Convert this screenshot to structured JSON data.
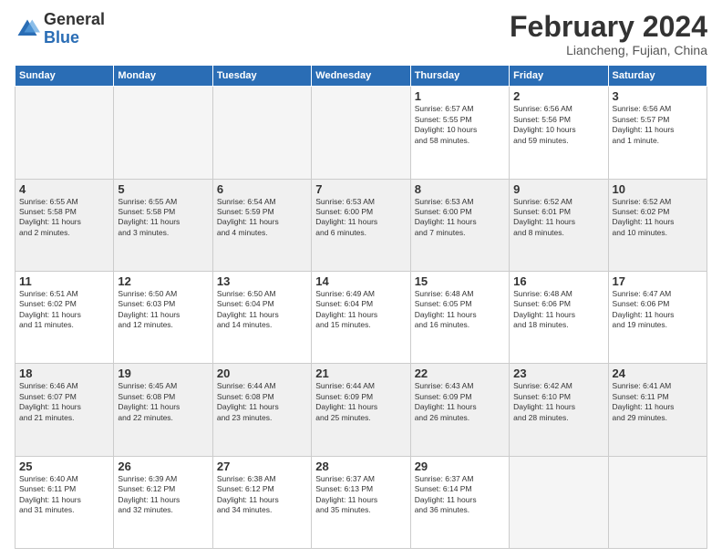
{
  "logo": {
    "general": "General",
    "blue": "Blue"
  },
  "header": {
    "month": "February 2024",
    "location": "Liancheng, Fujian, China"
  },
  "days_of_week": [
    "Sunday",
    "Monday",
    "Tuesday",
    "Wednesday",
    "Thursday",
    "Friday",
    "Saturday"
  ],
  "weeks": [
    [
      {
        "day": "",
        "info": ""
      },
      {
        "day": "",
        "info": ""
      },
      {
        "day": "",
        "info": ""
      },
      {
        "day": "",
        "info": ""
      },
      {
        "day": "1",
        "info": "Sunrise: 6:57 AM\nSunset: 5:55 PM\nDaylight: 10 hours\nand 58 minutes."
      },
      {
        "day": "2",
        "info": "Sunrise: 6:56 AM\nSunset: 5:56 PM\nDaylight: 10 hours\nand 59 minutes."
      },
      {
        "day": "3",
        "info": "Sunrise: 6:56 AM\nSunset: 5:57 PM\nDaylight: 11 hours\nand 1 minute."
      }
    ],
    [
      {
        "day": "4",
        "info": "Sunrise: 6:55 AM\nSunset: 5:58 PM\nDaylight: 11 hours\nand 2 minutes."
      },
      {
        "day": "5",
        "info": "Sunrise: 6:55 AM\nSunset: 5:58 PM\nDaylight: 11 hours\nand 3 minutes."
      },
      {
        "day": "6",
        "info": "Sunrise: 6:54 AM\nSunset: 5:59 PM\nDaylight: 11 hours\nand 4 minutes."
      },
      {
        "day": "7",
        "info": "Sunrise: 6:53 AM\nSunset: 6:00 PM\nDaylight: 11 hours\nand 6 minutes."
      },
      {
        "day": "8",
        "info": "Sunrise: 6:53 AM\nSunset: 6:00 PM\nDaylight: 11 hours\nand 7 minutes."
      },
      {
        "day": "9",
        "info": "Sunrise: 6:52 AM\nSunset: 6:01 PM\nDaylight: 11 hours\nand 8 minutes."
      },
      {
        "day": "10",
        "info": "Sunrise: 6:52 AM\nSunset: 6:02 PM\nDaylight: 11 hours\nand 10 minutes."
      }
    ],
    [
      {
        "day": "11",
        "info": "Sunrise: 6:51 AM\nSunset: 6:02 PM\nDaylight: 11 hours\nand 11 minutes."
      },
      {
        "day": "12",
        "info": "Sunrise: 6:50 AM\nSunset: 6:03 PM\nDaylight: 11 hours\nand 12 minutes."
      },
      {
        "day": "13",
        "info": "Sunrise: 6:50 AM\nSunset: 6:04 PM\nDaylight: 11 hours\nand 14 minutes."
      },
      {
        "day": "14",
        "info": "Sunrise: 6:49 AM\nSunset: 6:04 PM\nDaylight: 11 hours\nand 15 minutes."
      },
      {
        "day": "15",
        "info": "Sunrise: 6:48 AM\nSunset: 6:05 PM\nDaylight: 11 hours\nand 16 minutes."
      },
      {
        "day": "16",
        "info": "Sunrise: 6:48 AM\nSunset: 6:06 PM\nDaylight: 11 hours\nand 18 minutes."
      },
      {
        "day": "17",
        "info": "Sunrise: 6:47 AM\nSunset: 6:06 PM\nDaylight: 11 hours\nand 19 minutes."
      }
    ],
    [
      {
        "day": "18",
        "info": "Sunrise: 6:46 AM\nSunset: 6:07 PM\nDaylight: 11 hours\nand 21 minutes."
      },
      {
        "day": "19",
        "info": "Sunrise: 6:45 AM\nSunset: 6:08 PM\nDaylight: 11 hours\nand 22 minutes."
      },
      {
        "day": "20",
        "info": "Sunrise: 6:44 AM\nSunset: 6:08 PM\nDaylight: 11 hours\nand 23 minutes."
      },
      {
        "day": "21",
        "info": "Sunrise: 6:44 AM\nSunset: 6:09 PM\nDaylight: 11 hours\nand 25 minutes."
      },
      {
        "day": "22",
        "info": "Sunrise: 6:43 AM\nSunset: 6:09 PM\nDaylight: 11 hours\nand 26 minutes."
      },
      {
        "day": "23",
        "info": "Sunrise: 6:42 AM\nSunset: 6:10 PM\nDaylight: 11 hours\nand 28 minutes."
      },
      {
        "day": "24",
        "info": "Sunrise: 6:41 AM\nSunset: 6:11 PM\nDaylight: 11 hours\nand 29 minutes."
      }
    ],
    [
      {
        "day": "25",
        "info": "Sunrise: 6:40 AM\nSunset: 6:11 PM\nDaylight: 11 hours\nand 31 minutes."
      },
      {
        "day": "26",
        "info": "Sunrise: 6:39 AM\nSunset: 6:12 PM\nDaylight: 11 hours\nand 32 minutes."
      },
      {
        "day": "27",
        "info": "Sunrise: 6:38 AM\nSunset: 6:12 PM\nDaylight: 11 hours\nand 34 minutes."
      },
      {
        "day": "28",
        "info": "Sunrise: 6:37 AM\nSunset: 6:13 PM\nDaylight: 11 hours\nand 35 minutes."
      },
      {
        "day": "29",
        "info": "Sunrise: 6:37 AM\nSunset: 6:14 PM\nDaylight: 11 hours\nand 36 minutes."
      },
      {
        "day": "",
        "info": ""
      },
      {
        "day": "",
        "info": ""
      }
    ]
  ]
}
